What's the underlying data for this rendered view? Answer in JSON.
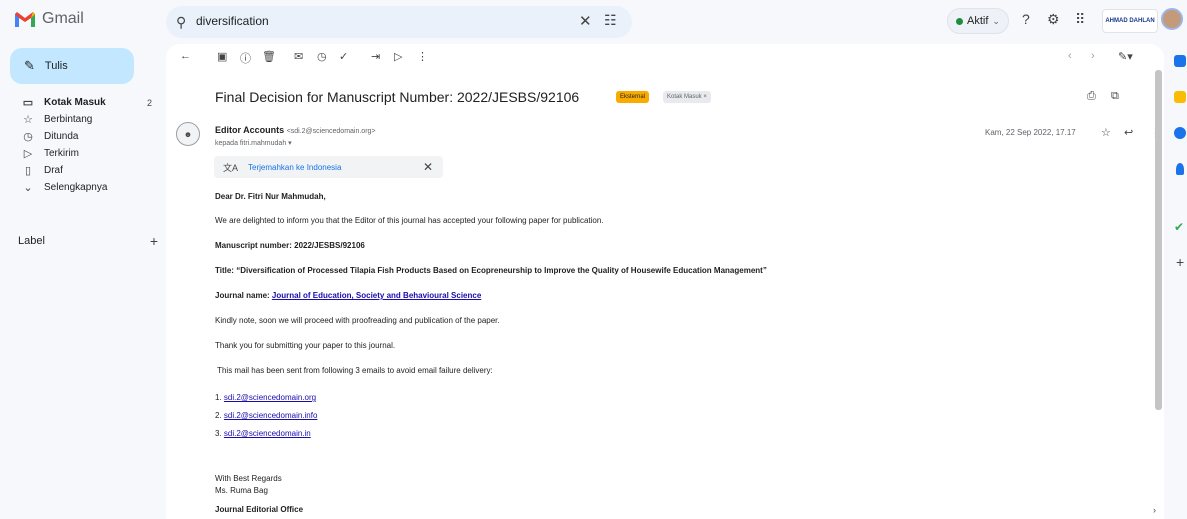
{
  "app": {
    "name": "Gmail"
  },
  "search": {
    "value": "diversification"
  },
  "status": {
    "label": "Aktif"
  },
  "org_badge": "AHMAD DAHLAN",
  "compose": {
    "label": "Tulis"
  },
  "nav": {
    "items": [
      {
        "label": "Kotak Masuk",
        "count": "2",
        "icon": "inbox-icon"
      },
      {
        "label": "Berbintang",
        "icon": "star-icon"
      },
      {
        "label": "Ditunda",
        "icon": "clock-icon"
      },
      {
        "label": "Terkirim",
        "icon": "send-icon"
      },
      {
        "label": "Draf",
        "icon": "draft-icon"
      },
      {
        "label": "Selengkapnya",
        "icon": "chevron-down-icon"
      }
    ],
    "labels_title": "Label"
  },
  "message": {
    "subject": "Final Decision for Manuscript Number: 2022/JESBS/92106",
    "chip_external": "Eksternal",
    "chip_inbox": "Kotak Masuk ×",
    "sender_name": "Editor Accounts",
    "sender_email": "<sdi.2@sciencedomain.org>",
    "recipient": "kepada fitri.mahmudah ▾",
    "date": "Kam, 22 Sep 2022, 17.17",
    "translate": "Terjemahkan ke Indonesia",
    "body": {
      "greeting": "Dear Dr. Fitri Nur Mahmudah,",
      "p1": "We are delighted to inform you that the Editor of this journal has accepted your following paper for publication.",
      "manuscript": "Manuscript number: 2022/JESBS/92106",
      "title": "Title: “Diversification of Processed Tilapia Fish Products Based on Ecopreneurship to Improve the Quality of Housewife Education Management”",
      "journal_label": "Journal name: ",
      "journal_link": "Journal of Education, Society and Behavioural Science",
      "p2": "Kindly note, soon we will proceed with proofreading and publication of the paper.",
      "p3": "Thank you for submitting your paper to this journal.",
      "p4": " This mail has been sent from following 3 emails to avoid email failure delivery:",
      "emails": [
        {
          "num": "1. ",
          "addr": "sdi.2@sciencedomain.org"
        },
        {
          "num": "2. ",
          "addr": "sdi.2@sciencedomain.info"
        },
        {
          "num": "3. ",
          "addr": "sdi.2@sciencedomain.in"
        }
      ],
      "regards": "With Best Regards",
      "signer": "Ms. Ruma Bag",
      "office": "Journal Editorial Office"
    }
  },
  "colors": {
    "compose_bg": "#c2e7ff",
    "chip_external": "#f9ab00",
    "active_dot": "#1e8e3e"
  }
}
